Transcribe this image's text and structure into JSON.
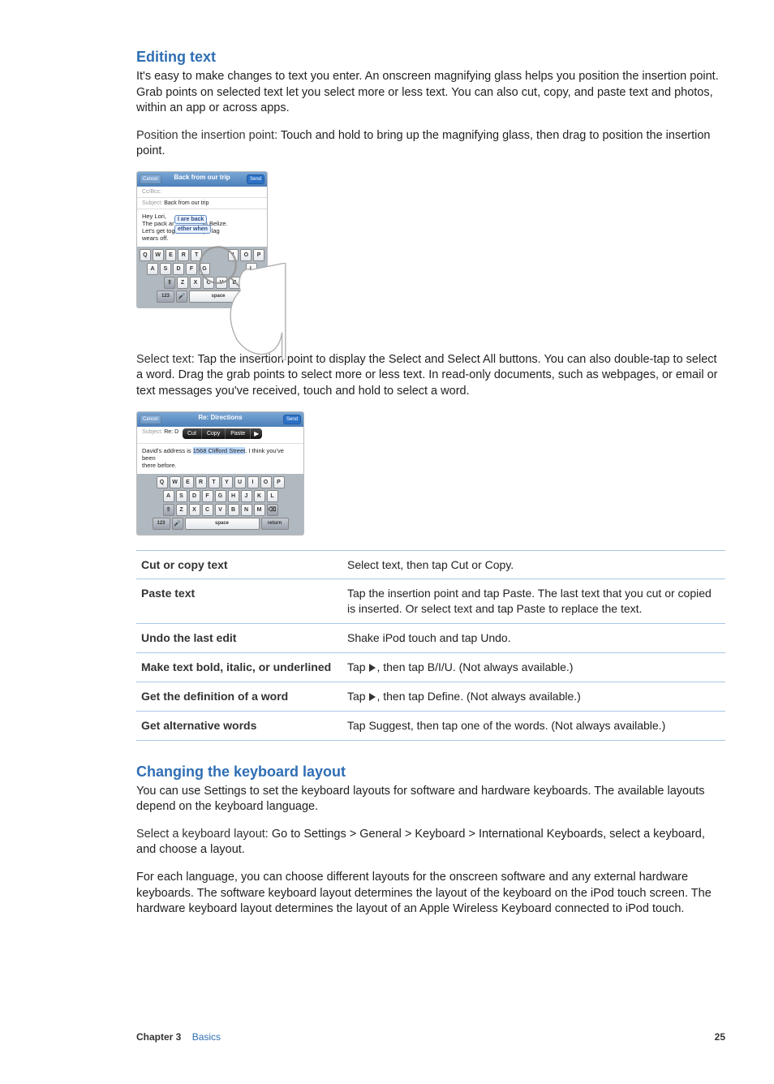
{
  "section1": {
    "heading": "Editing text",
    "intro": "It's easy to make changes to text you enter. An onscreen magnifying glass helps you position the insertion point. Grab points on selected text let you select more or less text. You can also cut, copy, and paste text and photos, within an app or across apps.",
    "position_label": "Position the insertion point:",
    "position_text": "  Touch and hold to bring up the magnifying glass, then drag to position the insertion point.",
    "select_label": "Select text:",
    "select_text": "  Tap the insertion point to display the Select and Select All buttons. You can also double-tap to select a word. Drag the grab points to select more or less text. In read-only documents, such as webpages, or email or text messages you've received, touch and hold to select a word."
  },
  "shot1": {
    "cancel": "Cancel",
    "title": "Back from our trip",
    "send": "Send",
    "ccbcc": "Cc/Bcc:",
    "subject_label": "Subject:",
    "subject_value": "Back from our trip",
    "body_l1": "Hey Lori,",
    "body_l2a": "The pack ar",
    "body_l2b": "m Belize.",
    "body_l3a": "Let's get tog",
    "body_l3b": "jet lag",
    "body_l4": "wears off.",
    "bubble1": "I are back",
    "bubble2": "ether when",
    "krow1": [
      "Q",
      "W",
      "E",
      "R",
      "T"
    ],
    "krow1b": [
      "I",
      "O",
      "P"
    ],
    "krow2": [
      "A",
      "S",
      "D",
      "F",
      "G"
    ],
    "krow2b": "L",
    "krow3": [
      "Z",
      "X",
      "C",
      "V",
      "B"
    ],
    "k123": "123",
    "kspace": "space"
  },
  "shot2": {
    "cancel": "Cancel",
    "title": "Re: Directions",
    "send": "Send",
    "subject_label": "Subject:",
    "subject_pref": "Re: D",
    "popup_cut": "Cut",
    "popup_copy": "Copy",
    "popup_paste": "Paste",
    "body_a": "David's address is ",
    "body_sel": "1568 Clifford Street",
    "body_b": ". I think you've been",
    "body_c": "there before.",
    "krow1": [
      "Q",
      "W",
      "E",
      "R",
      "T",
      "Y",
      "U",
      "I",
      "O",
      "P"
    ],
    "krow2": [
      "A",
      "S",
      "D",
      "F",
      "G",
      "H",
      "J",
      "K",
      "L"
    ],
    "krow3": [
      "Z",
      "X",
      "C",
      "V",
      "B",
      "N",
      "M"
    ],
    "k123": "123",
    "kspace": "space",
    "kreturn": "return"
  },
  "table": {
    "r1l": "Cut or copy text",
    "r1v": "Select text, then tap Cut or Copy.",
    "r2l": "Paste text",
    "r2v": "Tap the insertion point and tap Paste. The last text that you cut or copied is inserted. Or select text and tap Paste to replace the text.",
    "r3l": "Undo the last edit",
    "r3v": "Shake iPod touch and tap Undo.",
    "r4l": "Make text bold, italic, or underlined",
    "r4va": "Tap ",
    "r4vb": ", then tap B/I/U. (Not always available.)",
    "r5l": "Get the definition of a word",
    "r5va": "Tap ",
    "r5vb": ", then tap Define. (Not always available.)",
    "r6l": "Get alternative words",
    "r6v": "Tap Suggest, then tap one of the words. (Not always available.)"
  },
  "section2": {
    "heading": "Changing the keyboard layout",
    "p1": "You can use Settings to set the keyboard layouts for software and hardware keyboards. The available layouts depend on the keyboard language.",
    "p2_label": "Select a keyboard layout:",
    "p2_text": "  Go to Settings > General > Keyboard > International Keyboards, select a keyboard, and choose a layout.",
    "p3": "For each language, you can choose different layouts for the onscreen software and any external hardware keyboards. The software keyboard layout determines the layout of the keyboard on the iPod touch screen. The hardware keyboard layout determines the layout of an Apple Wireless Keyboard connected to iPod touch."
  },
  "footer": {
    "chapter": "Chapter 3",
    "title": "Basics",
    "page": "25"
  }
}
